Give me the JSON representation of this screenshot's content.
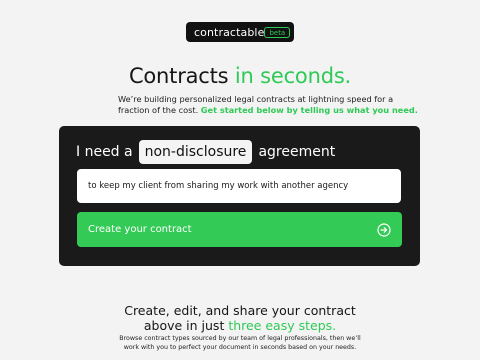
{
  "brand": {
    "name": "contractable",
    "badge": "beta"
  },
  "hero": {
    "title_main": "Contracts",
    "title_accent": "in seconds.",
    "subtitle_line1": "We’re building personalized legal contracts at lightning speed for a",
    "subtitle_line2_plain": "fraction of the cost.",
    "subtitle_line2_accent": "Get started below by telling us what you need."
  },
  "form": {
    "prefix": "I need a",
    "contract_type": "non-disclosure",
    "suffix": "agreement",
    "purpose_value": "to keep my client from sharing my work with another agency",
    "submit_label": "Create your contract",
    "submit_icon": "arrow-right-circle-icon"
  },
  "steps": {
    "title_line1": "Create, edit, and share your contract",
    "title_line2_plain": "above in just",
    "title_line2_accent": "three easy steps.",
    "desc_line1": "Browse contract types sourced by our team of legal professionals, then we’ll",
    "desc_line2": "work with you to perfect your document in seconds based on your needs."
  },
  "colors": {
    "accent": "#2fca55",
    "card": "#1a1a1a",
    "background": "#f3f3f3"
  }
}
